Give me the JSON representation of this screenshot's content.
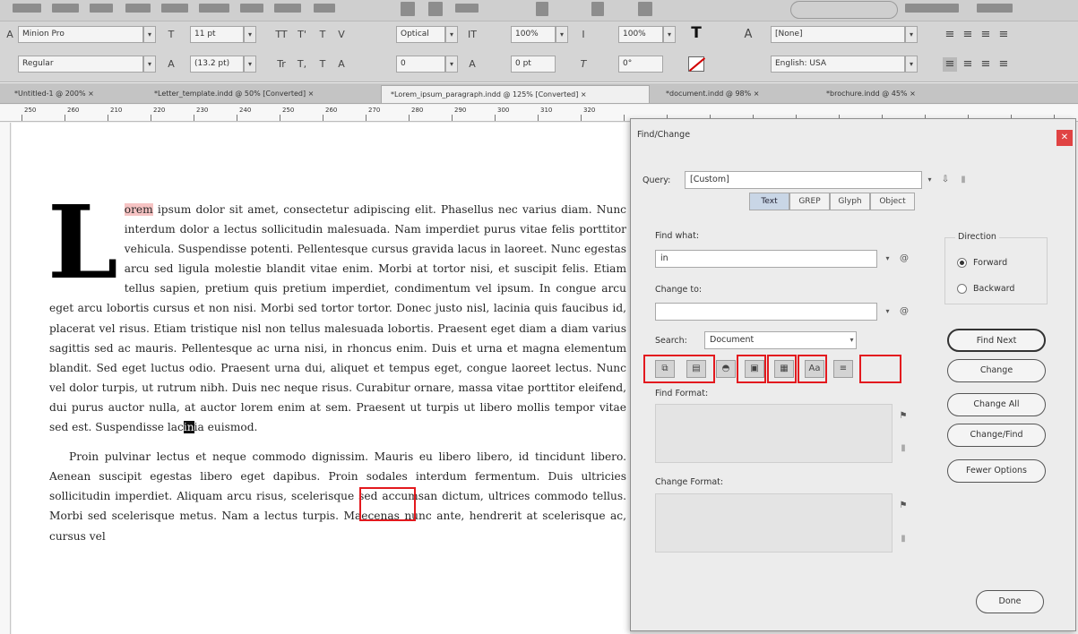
{
  "control_bar": {
    "font_family": "Minion Pro",
    "font_style": "Regular",
    "font_size": "11 pt",
    "leading": "(13.2 pt)",
    "kerning": "Optical",
    "tracking": "0",
    "vertical_scale": "100%",
    "baseline_shift": "0 pt",
    "horizontal_scale": "100%",
    "skew": "0°",
    "character_style": "[None]",
    "language": "English: USA"
  },
  "tabs": [
    "*Untitled-1 @ 200% ×",
    "*Letter_template.indd @ 50% [Converted] ×",
    "*Lorem_ipsum_paragraph.indd @ 125% [Converted] ×",
    "*document.indd @ 98% ×",
    "*brochure.indd @ 45% ×"
  ],
  "ruler": {
    "labels": [
      "250",
      "260",
      "210",
      "220",
      "230",
      "240",
      "250",
      "260",
      "270",
      "280",
      "290",
      "300",
      "310",
      "320"
    ]
  },
  "document": {
    "drop_cap": "L",
    "paragraph1": [
      {
        "t": "orem",
        "c": "hl"
      },
      {
        "t": " ipsum dolor sit amet, consectetur adipiscing elit. Phasellus nec varius diam. Nunc interdum dolor a lectus sollicitudin malesuada. Nam imperdiet purus vitae felis porttitor vehicula. Suspendisse potenti. Pellentesque cursus gravida lacus in laoreet. Nunc egestas arcu sed ligula molestie blandit vitae enim. Morbi at tortor nisi, et suscipit felis. Etiam tellus sapien, pretium quis pretium imperdiet, condimentum vel ipsum. In congue arcu eget arcu lobortis cursus et non nisi. Morbi sed tortor tortor. Donec justo nisl, lacinia quis faucibus id, placerat vel risus. Etiam tristique nisl non tellus malesuada lobortis. Praesent eget diam a diam varius sagittis sed ac mauris. Pellentesque ac urna nisi, in rhoncus enim. Duis et urna et magna elementum blandit. Sed eget luctus odio. Praesent urna dui, aliquet et tempus eget, congue laoreet lectus. Nunc vel dolor turpis, ut rutrum nibh. Duis nec neque risus. Curabitur ornare, massa vitae porttitor eleifend, dui purus auctor nulla, at auctor lorem enim at sem. Praesent ut turpis ut libero mollis tempor vitae sed est. Suspendisse lac"
      },
      {
        "t": "in",
        "c": "inv"
      },
      {
        "t": "ia euismod."
      }
    ],
    "paragraph2": "Proin pulvinar lectus et neque commodo dignissim. Mauris eu libero libero, id tincidunt libero. Aenean suscipit egestas libero eget dapibus. Proin sodales interdum fermentum. Duis ultricies sollicitudin imperdiet. Aliquam arcu risus, scelerisque sed accumsan dictum, ultrices commodo tellus. Morbi sed scelerisque metus. Nam a lectus turpis. Maecenas nunc ante, hendrerit at scelerisque ac, cursus vel"
  },
  "dialog": {
    "title": "Find/Change",
    "query_label": "Query:",
    "query_value": "[Custom]",
    "segments": [
      "Text",
      "GREP",
      "Glyph",
      "Object"
    ],
    "active_segment": "Text",
    "find_what_label": "Find what:",
    "find_what_value": "in",
    "change_to_label": "Change to:",
    "change_to_value": "",
    "search_label": "Search:",
    "search_value": "Document",
    "direction_label": "Direction",
    "direction_options": [
      "Forward",
      "Backward"
    ],
    "direction_selected": "Forward",
    "find_format_label": "Find Format:",
    "change_format_label": "Change Format:",
    "buttons": [
      "Find Next",
      "Change",
      "Change All",
      "Change/Find",
      "Fewer Options",
      "Done"
    ],
    "option_icons": [
      "locked-layers-icon",
      "locked-stories-icon",
      "hidden-layers-icon",
      "master-pages-icon",
      "footnotes-icon",
      "case-sensitive-icon",
      "whole-word-icon"
    ],
    "option_glyphs": [
      "⧉",
      "▤",
      "◓",
      "▣",
      "▦",
      "Aa",
      "≡"
    ],
    "colors": {
      "highlight_box": "#e3191e",
      "selection_pink": "#f6c3c3"
    }
  }
}
